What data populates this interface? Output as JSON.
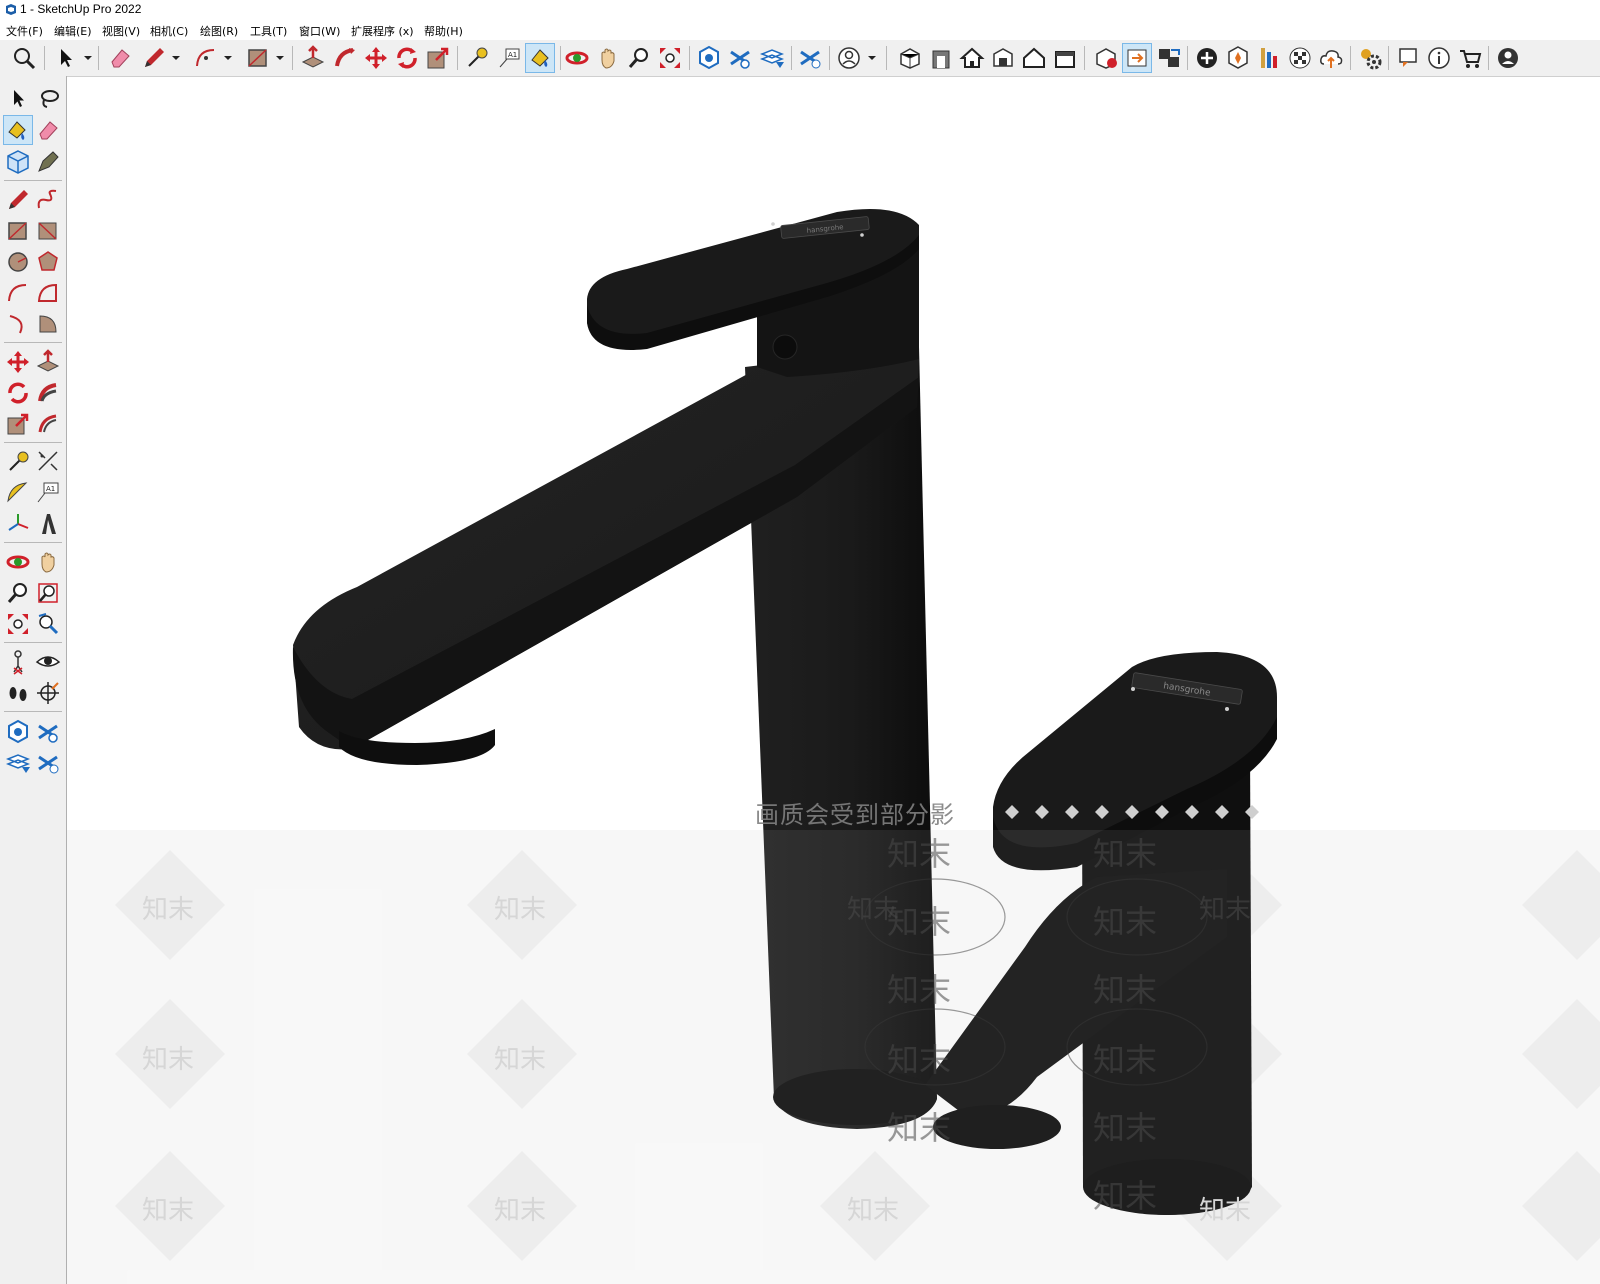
{
  "window": {
    "title": "1 - SketchUp Pro 2022"
  },
  "menus": [
    {
      "label": "文件(F)"
    },
    {
      "label": "编辑(E)"
    },
    {
      "label": "视图(V)"
    },
    {
      "label": "相机(C)"
    },
    {
      "label": "绘图(R)"
    },
    {
      "label": "工具(T)"
    },
    {
      "label": "窗口(W)"
    },
    {
      "label": "扩展程序 (x)"
    },
    {
      "label": "帮助(H)"
    }
  ],
  "top_toolbar": {
    "icons": [
      "zoom-icon",
      "select-icon",
      "eraser-icon",
      "pencil-icon",
      "arc-icon",
      "rectangle-icon",
      "push-pull-icon",
      "follow-me-icon",
      "move-icon",
      "rotate-icon",
      "scale-icon",
      "tape-measure-icon",
      "text-icon",
      "paint-bucket-icon",
      "orbit-icon",
      "pan-icon",
      "zoom-window-icon",
      "zoom-extents-icon",
      "model-info-icon",
      "layers-icon",
      "scenes-icon",
      "outliner-icon",
      "user-icon",
      "iso-view-icon",
      "front-view-icon",
      "home-icon",
      "top-view-icon",
      "right-view-icon",
      "back-view-icon",
      "warehouse-icon",
      "extension-warehouse-icon",
      "send-to-layout-icon",
      "add-location-icon",
      "geo-icon",
      "section-icon",
      "checker-icon",
      "cloud-icon",
      "gear-icon",
      "chat-icon",
      "info-icon",
      "cart-icon",
      "account-icon"
    ],
    "active": [
      "paint-bucket-icon",
      "extension-warehouse-icon"
    ]
  },
  "left_toolbar": {
    "icons": [
      "select-icon",
      "lasso-icon",
      "paint-bucket-icon",
      "eraser-icon",
      "component-icon",
      "tag-icon",
      "pencil-icon",
      "freehand-icon",
      "rectangle-icon",
      "rotated-rectangle-icon",
      "circle-icon",
      "polygon-icon",
      "arc-icon",
      "two-point-arc-icon",
      "three-point-arc-icon",
      "pie-icon",
      "move-icon",
      "push-pull-icon",
      "rotate-icon",
      "follow-me-icon",
      "scale-icon",
      "offset-icon",
      "tape-measure-icon",
      "dimension-icon",
      "protractor-icon",
      "text-icon",
      "axes-icon",
      "3d-text-icon",
      "orbit-icon",
      "pan-icon",
      "zoom-icon",
      "zoom-window-icon",
      "zoom-extents-icon",
      "previous-view-icon",
      "position-camera-icon",
      "look-around-icon",
      "walk-icon",
      "section-plane-icon",
      "model-info-icon",
      "layers-icon",
      "scenes-icon",
      "outliner-icon"
    ],
    "active": [
      "paint-bucket-icon"
    ]
  },
  "viewport": {
    "overlay_text": "画质会受到部分影",
    "watermark_text": "知末",
    "logo_text": "hansgrohe",
    "colors": {
      "faucet": "#1b1b1b",
      "faucet_dark": "#0d0d0d",
      "highlight": "#262626",
      "background": "#ffffff",
      "watermark_band": "#f7f7f7"
    }
  }
}
